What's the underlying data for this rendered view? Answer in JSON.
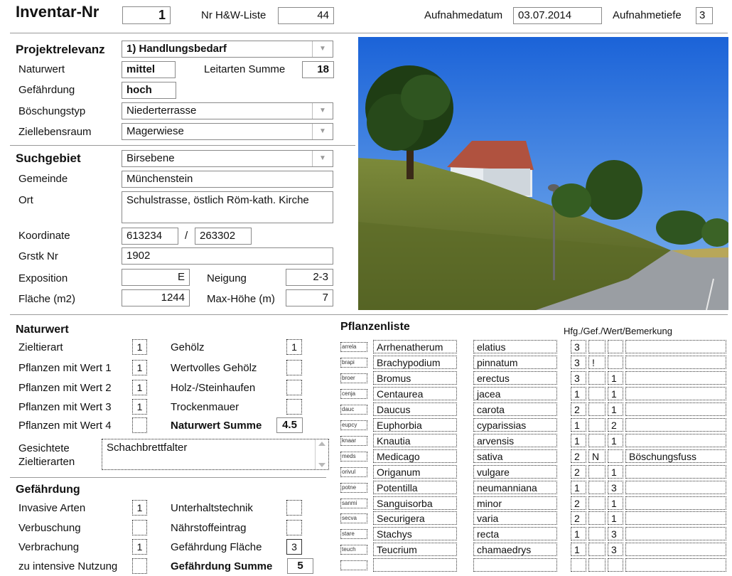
{
  "header": {
    "inventar_label": "Inventar-Nr",
    "inventar_value": "1",
    "hw_label": "Nr H&W-Liste",
    "hw_value": "44",
    "date_label": "Aufnahmedatum",
    "date_value": "03.07.2014",
    "depth_label": "Aufnahmetiefe",
    "depth_value": "3"
  },
  "projekt": {
    "label": "Projektrelevanz",
    "value": "1) Handlungsbedarf",
    "naturwert_label": "Naturwert",
    "naturwert_value": "mittel",
    "leitarten_label": "Leitarten Summe",
    "leitarten_value": "18",
    "gefaehrdung_label": "Gefährdung",
    "gefaehrdung_value": "hoch",
    "boeschung_label": "Böschungstyp",
    "boeschung_value": "Niederterrasse",
    "ziel_label": "Ziellebensraum",
    "ziel_value": "Magerwiese"
  },
  "such": {
    "label": "Suchgebiet",
    "value": "Birsebene",
    "gemeinde_label": "Gemeinde",
    "gemeinde_value": "Münchenstein",
    "ort_label": "Ort",
    "ort_value": "Schulstrasse, östlich Röm-kath. Kirche",
    "koord_label": "Koordinate",
    "koord_x": "613234",
    "koord_sep": "/",
    "koord_y": "263302",
    "grstk_label": "Grstk Nr",
    "grstk_value": "1902",
    "expo_label": "Exposition",
    "expo_value": "E",
    "neigung_label": "Neigung",
    "neigung_value": "2-3",
    "flaeche_label": "Fläche (m2)",
    "flaeche_value": "1244",
    "maxh_label": "Max-Höhe (m)",
    "maxh_value": "7"
  },
  "naturwert": {
    "title": "Naturwert",
    "left": [
      {
        "label": "Zieltierart",
        "value": "1"
      },
      {
        "label": "Pflanzen mit Wert  1",
        "value": "1"
      },
      {
        "label": "Pflanzen mit Wert  2",
        "value": "1"
      },
      {
        "label": "Pflanzen mit Wert  3",
        "value": "1"
      },
      {
        "label": "Pflanzen mit Wert  4",
        "value": ""
      }
    ],
    "right": [
      {
        "label": "Gehölz",
        "value": "1"
      },
      {
        "label": "Wertvolles Gehölz",
        "value": ""
      },
      {
        "label": "Holz-/Steinhaufen",
        "value": ""
      },
      {
        "label": "Trockenmauer",
        "value": ""
      }
    ],
    "summe_label": "Naturwert Summe",
    "summe_value": "4.5",
    "gesichtete_label_1": "Gesichtete",
    "gesichtete_label_2": "Zieltierarten",
    "gesichtete_value": "Schachbrettfalter"
  },
  "gefaehrdung": {
    "title": "Gefährdung",
    "left": [
      {
        "label": "Invasive Arten",
        "value": "1"
      },
      {
        "label": "Verbuschung",
        "value": ""
      },
      {
        "label": "Verbrachung",
        "value": "1"
      },
      {
        "label": "zu intensive Nutzung",
        "value": ""
      }
    ],
    "right": [
      {
        "label": "Unterhaltstechnik",
        "value": ""
      },
      {
        "label": "Nährstoffeintrag",
        "value": ""
      },
      {
        "label": "Gefährdung Fläche",
        "value": "3"
      }
    ],
    "summe_label": "Gefährdung Summe",
    "summe_value": "5"
  },
  "pflanzen": {
    "title": "Pflanzenliste",
    "columns_label": "Hfg./Gef./Wert/Bemerkung",
    "rows": [
      {
        "code": "arrela",
        "genus": "Arrhenatherum",
        "species": "elatius",
        "hfg": "3",
        "gef": "",
        "wert": "",
        "bem": ""
      },
      {
        "code": "brapi",
        "genus": "Brachypodium",
        "species": "pinnatum",
        "hfg": "3",
        "gef": "!",
        "wert": "",
        "bem": ""
      },
      {
        "code": "broer",
        "genus": "Bromus",
        "species": "erectus",
        "hfg": "3",
        "gef": "",
        "wert": "1",
        "bem": ""
      },
      {
        "code": "cenja",
        "genus": "Centaurea",
        "species": "jacea",
        "hfg": "1",
        "gef": "",
        "wert": "1",
        "bem": ""
      },
      {
        "code": "dauc",
        "genus": "Daucus",
        "species": "carota",
        "hfg": "2",
        "gef": "",
        "wert": "1",
        "bem": ""
      },
      {
        "code": "eupcy",
        "genus": "Euphorbia",
        "species": "cyparissias",
        "hfg": "1",
        "gef": "",
        "wert": "2",
        "bem": ""
      },
      {
        "code": "knaar",
        "genus": "Knautia",
        "species": "arvensis",
        "hfg": "1",
        "gef": "",
        "wert": "1",
        "bem": ""
      },
      {
        "code": "meds",
        "genus": "Medicago",
        "species": "sativa",
        "hfg": "2",
        "gef": "N",
        "wert": "",
        "bem": "Böschungsfuss"
      },
      {
        "code": "orivul",
        "genus": "Origanum",
        "species": "vulgare",
        "hfg": "2",
        "gef": "",
        "wert": "1",
        "bem": ""
      },
      {
        "code": "potne",
        "genus": "Potentilla",
        "species": "neumanniana",
        "hfg": "1",
        "gef": "",
        "wert": "3",
        "bem": ""
      },
      {
        "code": "sanmi",
        "genus": "Sanguisorba",
        "species": "minor",
        "hfg": "2",
        "gef": "",
        "wert": "1",
        "bem": ""
      },
      {
        "code": "secva",
        "genus": "Securigera",
        "species": "varia",
        "hfg": "2",
        "gef": "",
        "wert": "1",
        "bem": ""
      },
      {
        "code": "stare",
        "genus": "Stachys",
        "species": "recta",
        "hfg": "1",
        "gef": "",
        "wert": "3",
        "bem": ""
      },
      {
        "code": "teuch",
        "genus": "Teucrium",
        "species": "chamaedrys",
        "hfg": "1",
        "gef": "",
        "wert": "3",
        "bem": ""
      },
      {
        "code": "",
        "genus": "",
        "species": "",
        "hfg": "",
        "gef": "",
        "wert": "",
        "bem": ""
      }
    ]
  }
}
